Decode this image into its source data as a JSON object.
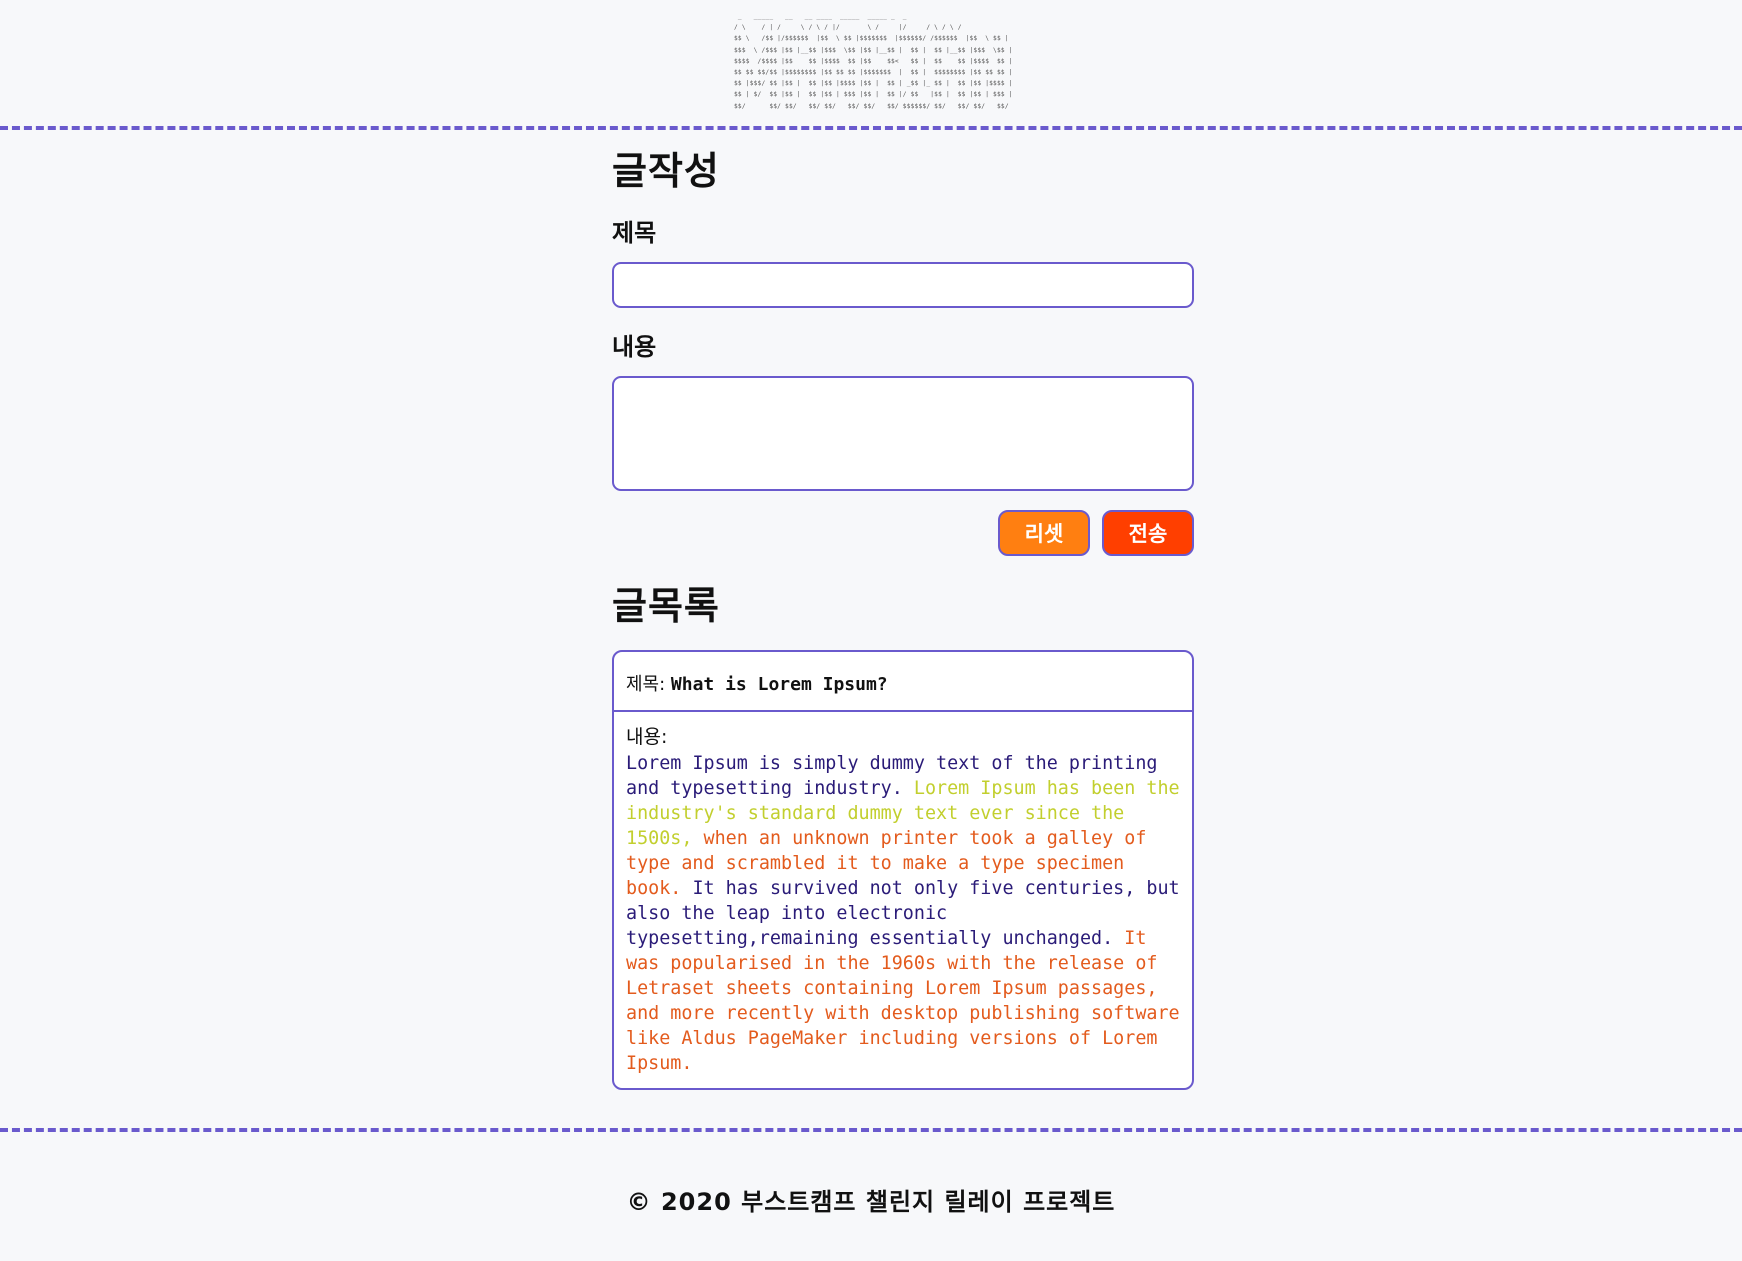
{
  "header": {
    "ascii_art": " _   _____   __   __ ____  _____  _____ _  _\n/ \\    / | /     \\ / \\ / |/       \\ /     |/     / \\ / \\ / \n$$ \\   /$$ |/$$$$$$  |$$  \\ $$ |$$$$$$$  |$$$$$$/ /$$$$$$  |$$  \\ $$ |\n$$$  \\ /$$$ |$$ |__$$ |$$$  \\$$ |$$ |__$$ |  $$ |  $$ |__$$ |$$$  \\$$ |\n$$$$  /$$$$ |$$    $$ |$$$$  $$ |$$    $$<   $$ |  $$    $$ |$$$$  $$ |\n$$ $$ $$/$$ |$$$$$$$$ |$$ $$ $$ |$$$$$$$  |  $$ |  $$$$$$$$ |$$ $$ $$ |\n$$ |$$$/ $$ |$$ |  $$ |$$ |$$$$ |$$ |  $$ | _$$ |_ $$ |  $$ |$$ |$$$$ |\n$$ | $/  $$ |$$ |  $$ |$$ | $$$ |$$ |  $$ |/ $$   |$$ |  $$ |$$ | $$$ |\n$$/      $$/ $$/   $$/ $$/   $$/ $$/   $$/ $$$$$$/ $$/   $$/ $$/   $$/"
  },
  "write": {
    "heading": "글작성",
    "title_label": "제목",
    "title_value": "",
    "content_label": "내용",
    "content_value": "",
    "reset_label": "리셋",
    "submit_label": "전송"
  },
  "list": {
    "heading": "글목록",
    "posts": [
      {
        "title_key": "제목: ",
        "title": "What is Lorem Ipsum?",
        "content_key": "내용:",
        "content_segments": [
          {
            "text": "Lorem Ipsum is simply dummy text of the printing and typesetting industry. ",
            "color": "#2a1b78"
          },
          {
            "text": "Lorem Ipsum has been the industry's standard dummy text ever since the 1500s, ",
            "color": "#c2cf2e"
          },
          {
            "text": "when an unknown printer took a galley of type and scrambled it to make a type specimen book. ",
            "color": "#e35b1d"
          },
          {
            "text": "It has survived not only five centuries, but also the leap into electronic typesetting,remaining essentially unchanged. ",
            "color": "#2a1b78"
          },
          {
            "text": "It was popularised in the 1960s with the release of Letraset sheets containing Lorem Ipsum passages, and more recently with desktop publishing software like Aldus PageMaker including versions of Lorem Ipsum.",
            "color": "#e35b1d"
          }
        ]
      }
    ]
  },
  "footer": {
    "text": "© 2020 부스트캠프 챌린지 릴레이 프로젝트"
  },
  "colors": {
    "accent": "#6a5acd",
    "reset_button": "#ff7f11",
    "submit_button": "#ff3f00",
    "background": "#f7f8fa"
  }
}
